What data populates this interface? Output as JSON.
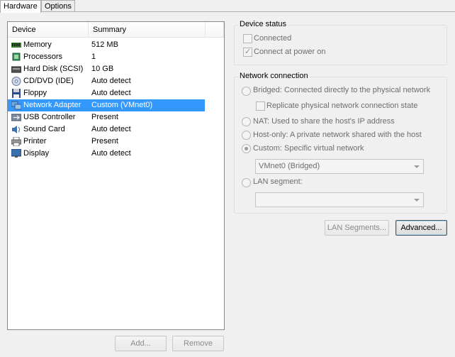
{
  "tabs": [
    {
      "label": "Hardware"
    },
    {
      "label": "Options"
    }
  ],
  "device_list": {
    "columns": [
      "Device",
      "Summary"
    ],
    "rows": [
      {
        "device": "Memory",
        "summary": "512 MB",
        "icon": "memory-icon"
      },
      {
        "device": "Processors",
        "summary": "1",
        "icon": "processor-icon"
      },
      {
        "device": "Hard Disk (SCSI)",
        "summary": "10 GB",
        "icon": "hard-disk-icon"
      },
      {
        "device": "CD/DVD (IDE)",
        "summary": "Auto detect",
        "icon": "cd-dvd-icon"
      },
      {
        "device": "Floppy",
        "summary": "Auto detect",
        "icon": "floppy-icon"
      },
      {
        "device": "Network Adapter",
        "summary": "Custom (VMnet0)",
        "icon": "network-adapter-icon",
        "selected": true
      },
      {
        "device": "USB Controller",
        "summary": "Present",
        "icon": "usb-icon"
      },
      {
        "device": "Sound Card",
        "summary": "Auto detect",
        "icon": "sound-card-icon"
      },
      {
        "device": "Printer",
        "summary": "Present",
        "icon": "printer-icon"
      },
      {
        "device": "Display",
        "summary": "Auto detect",
        "icon": "display-icon"
      }
    ]
  },
  "buttons": {
    "add": "Add...",
    "remove": "Remove",
    "lan_segments": "LAN Segments...",
    "advanced": "Advanced..."
  },
  "device_status": {
    "title": "Device status",
    "connected": {
      "label": "Connected",
      "checked": false
    },
    "connect_at_power_on": {
      "label": "Connect at power on",
      "checked": true
    }
  },
  "network_connection": {
    "title": "Network connection",
    "bridged": "Bridged: Connected directly to the physical network",
    "replicate": "Replicate physical network connection state",
    "nat": "NAT: Used to share the host's IP address",
    "host_only": "Host-only: A private network shared with the host",
    "custom": "Custom: Specific virtual network",
    "custom_selected_value": "VMnet0 (Bridged)",
    "lan_segment": "LAN segment:",
    "lan_segment_value": "",
    "selected_option": "custom"
  },
  "colors": {
    "selection": "#3399ff",
    "panel": "#f0f0f0"
  }
}
